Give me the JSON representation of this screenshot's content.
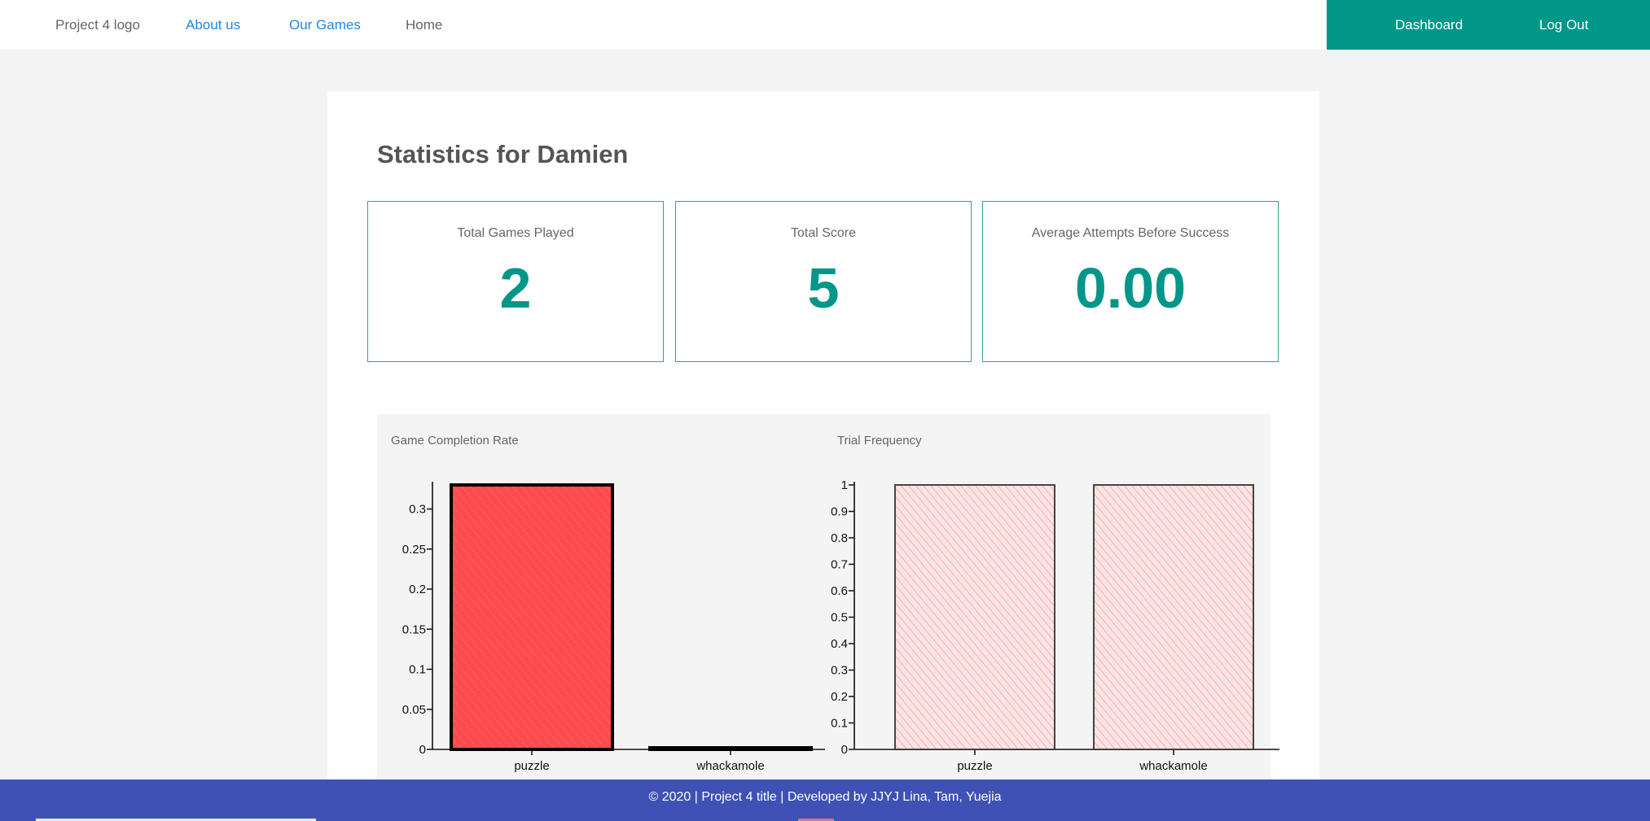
{
  "nav": {
    "logo": "Project 4 logo",
    "about": "About us",
    "games": "Our Games",
    "home": "Home",
    "dashboard": "Dashboard",
    "logout": "Log Out"
  },
  "page": {
    "title": "Statistics for Damien"
  },
  "stats": [
    {
      "label": "Total Games Played",
      "value": "2"
    },
    {
      "label": "Total Score",
      "value": "5"
    },
    {
      "label": "Average Attempts Before Success",
      "value": "0.00"
    }
  ],
  "charts": {
    "completion_title": "Game Completion Rate",
    "trial_title": "Trial Frequency"
  },
  "chart_data": [
    {
      "type": "bar",
      "title": "Game Completion Rate",
      "categories": [
        "puzzle",
        "whackamole"
      ],
      "values": [
        0.33,
        0
      ],
      "ylim": [
        0,
        0.33
      ],
      "yticks": [
        0,
        0.05,
        0.1,
        0.15,
        0.2,
        0.25,
        0.3
      ],
      "grid": false,
      "bar_color": "#ff4a4f"
    },
    {
      "type": "bar",
      "title": "Trial Frequency",
      "categories": [
        "puzzle",
        "whackamole"
      ],
      "values": [
        1,
        1
      ],
      "ylim": [
        0,
        1
      ],
      "yticks": [
        0,
        0.1,
        0.2,
        0.3,
        0.4,
        0.5,
        0.6,
        0.7,
        0.8,
        0.9,
        1
      ],
      "grid": false,
      "bar_color": "#f4a6aa"
    }
  ],
  "footer": {
    "text": "© 2020 | Project 4 title | Developed by JJYJ Lina, Tam, Yuejia"
  },
  "colors": {
    "accent": "#009688",
    "footer": "#3f51b5",
    "link": "#1e88e5"
  }
}
